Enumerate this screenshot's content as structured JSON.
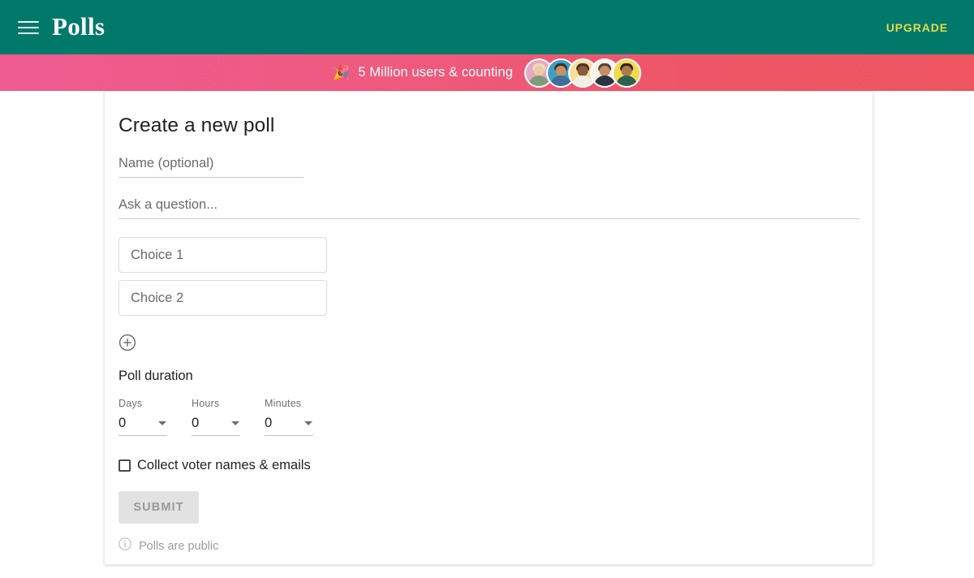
{
  "header": {
    "menu_icon": "hamburger-menu-icon",
    "brand": "Polls",
    "upgrade_label": "UPGRADE",
    "background_color": "#00796B",
    "upgrade_color": "#E8D94A"
  },
  "promo_banner": {
    "emoji": "🎉",
    "text": "5 Million users & counting",
    "gradient_from": "#EE5B90",
    "gradient_to": "#EE5560",
    "avatars": [
      {
        "name": "avatar-1",
        "bg": "#E6A8C4",
        "hair": "#E8DCC0",
        "skin": "#F0C9A8",
        "body": "#7E9B7A"
      },
      {
        "name": "avatar-2",
        "bg": "#3FA0C4",
        "hair": "#3A3330",
        "skin": "#C98E63",
        "body": "#3E6F97"
      },
      {
        "name": "avatar-3",
        "bg": "#F6DE9E",
        "hair": "#4A3226",
        "skin": "#8D5A3B",
        "body": "#F2EFE6"
      },
      {
        "name": "avatar-4",
        "bg": "#F4F1E8",
        "hair": "#51463F",
        "skin": "#C98E63",
        "body": "#2B3342"
      },
      {
        "name": "avatar-5",
        "bg": "#F4D94E",
        "hair": "#2C2520",
        "skin": "#B07A4E",
        "body": "#2E6151"
      }
    ]
  },
  "poll_form": {
    "title": "Create a new poll",
    "name_placeholder": "Name (optional)",
    "name_value": "",
    "question_placeholder": "Ask a question...",
    "question_value": "",
    "choices": [
      {
        "placeholder": "Choice 1",
        "value": ""
      },
      {
        "placeholder": "Choice 2",
        "value": ""
      }
    ],
    "add_choice_icon": "plus-circle-icon",
    "duration_label": "Poll duration",
    "duration": [
      {
        "caption": "Days",
        "value": "0"
      },
      {
        "caption": "Hours",
        "value": "0"
      },
      {
        "caption": "Minutes",
        "value": "0"
      }
    ],
    "collect_checkbox_label": "Collect voter names & emails",
    "collect_checked": false,
    "submit_label": "SUBMIT",
    "submit_disabled": true,
    "note_icon": "info-icon",
    "note_text": "Polls are public"
  }
}
